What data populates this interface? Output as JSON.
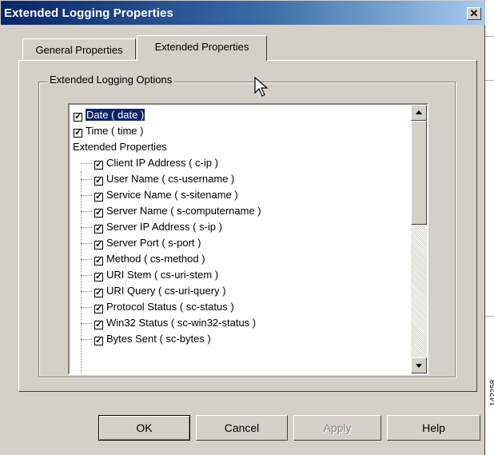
{
  "window": {
    "title": "Extended Logging Properties",
    "close_label": "✕"
  },
  "tabs": [
    {
      "label": "General Properties",
      "selected": false
    },
    {
      "label": "Extended Properties",
      "selected": true
    }
  ],
  "group": {
    "label": "Extended Logging Options"
  },
  "options": {
    "date": {
      "label": "Date ( date )",
      "checked": true,
      "selected": true
    },
    "time": {
      "label": "Time ( time )",
      "checked": true
    },
    "extended_header": "Extended Properties",
    "extended": [
      {
        "label": "Client IP Address ( c-ip )",
        "checked": true
      },
      {
        "label": "User Name ( cs-username )",
        "checked": true
      },
      {
        "label": "Service Name ( s-sitename )",
        "checked": true
      },
      {
        "label": "Server Name ( s-computername )",
        "checked": true
      },
      {
        "label": "Server IP Address ( s-ip )",
        "checked": true
      },
      {
        "label": "Server Port ( s-port )",
        "checked": true
      },
      {
        "label": "Method ( cs-method )",
        "checked": true
      },
      {
        "label": "URI Stem ( cs-uri-stem )",
        "checked": true
      },
      {
        "label": "URI Query ( cs-uri-query )",
        "checked": true
      },
      {
        "label": "Protocol Status ( sc-status )",
        "checked": true
      },
      {
        "label": "Win32 Status ( sc-win32-status )",
        "checked": true
      },
      {
        "label": "Bytes Sent ( sc-bytes )",
        "checked": true
      }
    ]
  },
  "buttons": {
    "ok": "OK",
    "cancel": "Cancel",
    "apply": "Apply",
    "help": "Help"
  },
  "side_code": "142258",
  "colors": {
    "title_start": "#0a246a",
    "title_end": "#a6caf0",
    "face": "#d4d0c8",
    "selection": "#0a246a"
  }
}
